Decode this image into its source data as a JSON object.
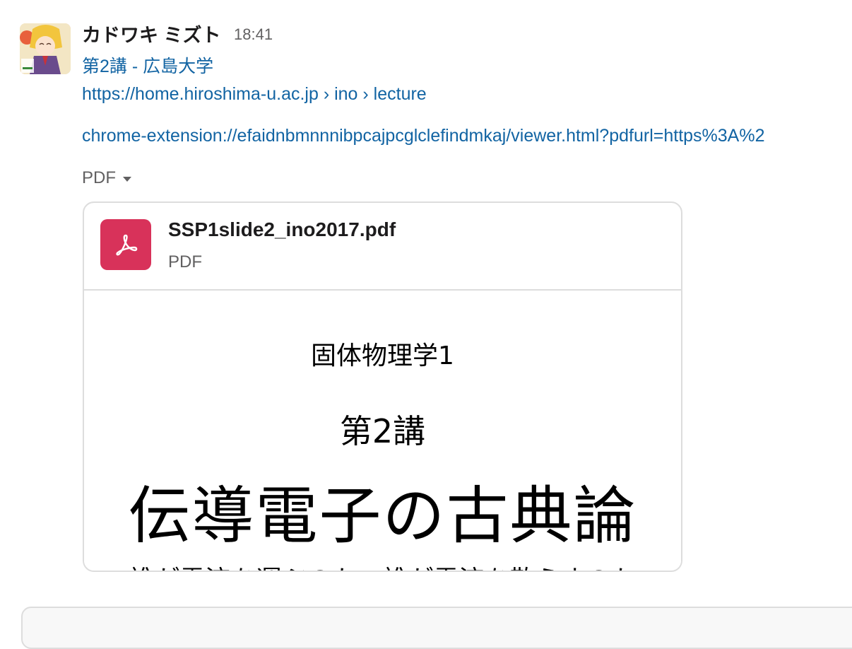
{
  "message": {
    "sender": "カドワキ ミズト",
    "timestamp": "18:41",
    "link_title": "第2講 - 広島大学",
    "link_breadcrumb": "https://home.hiroshima-u.ac.jp › ino › lecture",
    "link_extension": "chrome-extension://efaidnbmnnnibpcajpcglclefindmkaj/viewer.html?pdfurl=https%3A%2",
    "attachment_toggle_label": "PDF"
  },
  "file": {
    "name": "SSP1slide2_ino2017.pdf",
    "type": "PDF",
    "icon": "pdf-icon",
    "icon_color": "#d8325a"
  },
  "preview": {
    "course": "固体物理学1",
    "lecture": "第2講",
    "title": "伝導電子の古典論",
    "subtitle": "誰が電流を運ぶのか、誰が電流を散らすのか"
  },
  "colors": {
    "link": "#1264a3",
    "muted": "#616061",
    "border": "#dddddd"
  }
}
